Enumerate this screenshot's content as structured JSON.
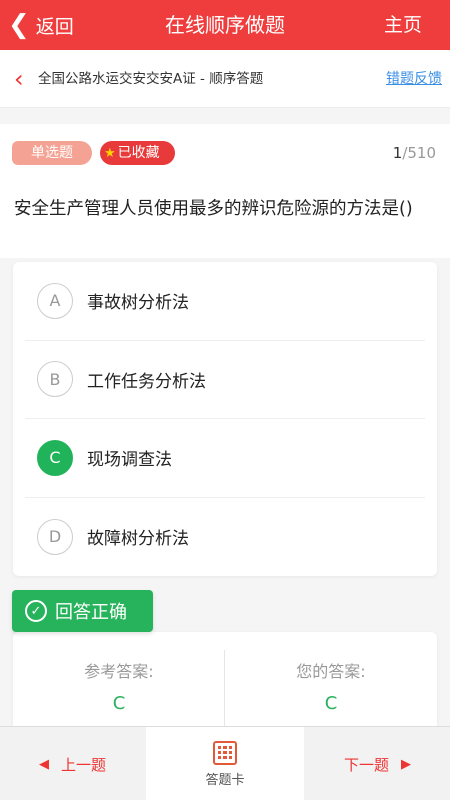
{
  "topbar": {
    "back_label": "返回",
    "title": "在线顺序做题",
    "home_label": "主页"
  },
  "crumb": {
    "text": "全国公路水运交安交安A证 - 顺序答题",
    "feedback_label": "错题反馈"
  },
  "question_header": {
    "type_label": "单选题",
    "favorite_label": "已收藏",
    "current": "1",
    "total": "/510"
  },
  "question": {
    "text": "安全生产管理人员使用最多的辨识危险源的方法是()"
  },
  "options": [
    {
      "letter": "A",
      "text": "事故树分析法",
      "selected": false
    },
    {
      "letter": "B",
      "text": "工作任务分析法",
      "selected": false
    },
    {
      "letter": "C",
      "text": "现场调查法",
      "selected": true
    },
    {
      "letter": "D",
      "text": "故障树分析法",
      "selected": false
    }
  ],
  "result": {
    "label": "回答正确",
    "color": "#27b35b"
  },
  "answers": {
    "reference_label": "参考答案:",
    "reference_value": "C",
    "yours_label": "您的答案:",
    "yours_value": "C"
  },
  "bottom": {
    "prev_label": "上一题",
    "card_label": "答题卡",
    "next_label": "下一题"
  },
  "colors": {
    "brand": "#ef3d3d",
    "correct": "#21b35a",
    "link": "#3a8ee6"
  }
}
